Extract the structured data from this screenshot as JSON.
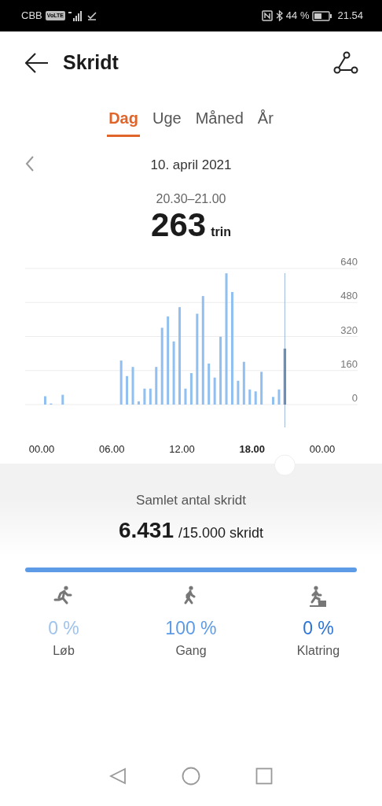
{
  "status_bar": {
    "carrier": "CBB",
    "volte": "VoLTE",
    "battery": "44 %",
    "time": "21.54"
  },
  "header": {
    "title": "Skridt"
  },
  "tabs": [
    {
      "label": "Dag",
      "selected": true
    },
    {
      "label": "Uge",
      "selected": false
    },
    {
      "label": "Måned",
      "selected": false
    },
    {
      "label": "År",
      "selected": false
    }
  ],
  "date": "10. april 2021",
  "selection": {
    "range": "20.30–21.00",
    "value": "263",
    "unit": "trin"
  },
  "chart_data": {
    "type": "bar",
    "categories": [
      "00.00",
      null,
      null,
      null,
      null,
      null,
      null,
      null,
      null,
      null,
      null,
      null,
      "06.00",
      null,
      null,
      null,
      null,
      null,
      null,
      null,
      null,
      null,
      null,
      null,
      "12.00",
      null,
      null,
      null,
      null,
      null,
      null,
      null,
      null,
      null,
      null,
      null,
      "18.00",
      null,
      null,
      null,
      null,
      null,
      null,
      null,
      null,
      null,
      null,
      null,
      "00.00"
    ],
    "values": [
      39,
      5,
      0,
      46,
      0,
      0,
      0,
      0,
      0,
      0,
      0,
      0,
      0,
      207,
      134,
      177,
      15,
      75,
      75,
      177,
      361,
      414,
      297,
      458,
      75,
      148,
      427,
      510,
      193,
      127,
      319,
      617,
      529,
      112,
      201,
      71,
      62,
      154,
      0,
      36,
      71,
      263,
      0,
      0,
      0,
      0,
      0,
      0,
      null
    ],
    "ylim": [
      0,
      640
    ],
    "yticks": [
      0,
      160,
      320,
      480,
      640
    ],
    "grid": true
  },
  "summary": {
    "label": "Samlet antal skridt",
    "total": "6.431",
    "goal": "/15.000 skridt"
  },
  "activities": [
    {
      "kind": "run",
      "percent": "0 %",
      "label": "Løb",
      "color": "#9fc3ec"
    },
    {
      "kind": "walk",
      "percent": "100 %",
      "label": "Gang",
      "level": 1,
      "color": "#5e9be6"
    },
    {
      "kind": "climb",
      "percent": "0 %",
      "label": "Klatring",
      "color": "#2a73d8"
    }
  ]
}
